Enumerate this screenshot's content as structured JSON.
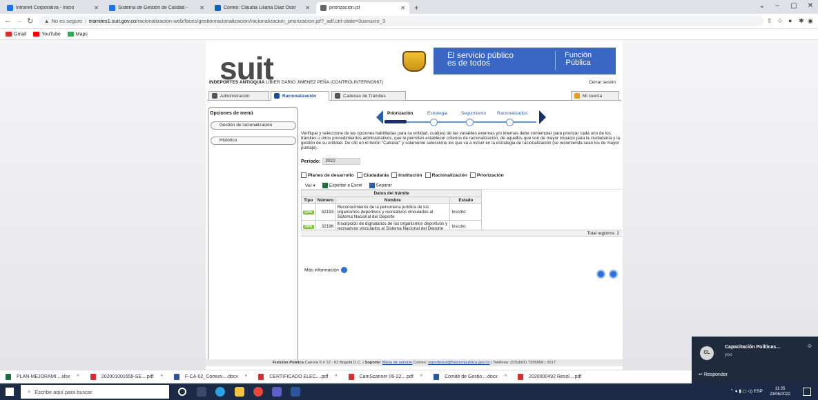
{
  "browser": {
    "tabs": [
      {
        "title": "Intranet Corporativa - Inicio",
        "color": "#1a73e8"
      },
      {
        "title": "Sistema de Gestión de Calidad -",
        "color": "#1a73e8"
      },
      {
        "title": "Correo: Claudia Liliana Díaz Osor",
        "color": "#0a66c2"
      },
      {
        "title": "priorizacion.jsf",
        "color": "#666666"
      }
    ],
    "new_tab": "+",
    "security": "No es seguro",
    "url_host": "tramites1.suit.gov.co",
    "url_path": "/racionalizacion-web/faces/gestionracionalizacion/racionalizacion_priorizacion.jsf?_adf.ctrl-state=3usnuxro_3",
    "bookmarks": [
      {
        "label": "Gmail",
        "color": "#d93025"
      },
      {
        "label": "YouTube",
        "color": "#ff0000"
      },
      {
        "label": "Maps",
        "color": "#34a853"
      }
    ]
  },
  "site": {
    "logo": "suit",
    "banner_line1": "El servicio público",
    "banner_line2": "es de todos",
    "banner_right1": "Función",
    "banner_right2": "Pública",
    "user_entity": "INDEPORTES ANTIOQUIA",
    "user_name": "LIBIER DARIO JIMENEZ PEÑA (CONTROLINTERNO967)",
    "logout": "Cerrar sesión",
    "nav_tabs": [
      "Administración",
      "Racionalización",
      "Cadenas de Trámites"
    ],
    "my_account": "Mi cuenta",
    "menu_title": "Opciones de menú",
    "menu_items": [
      "Gestión de racionalización",
      "Histórico"
    ],
    "steps": [
      "Priorización",
      "Estrategia",
      "Seguimiento",
      "Racionalizados"
    ],
    "description": "Verifique y seleccione de las opciones habilitadas para su entidad, cuál(es) de las variables externas y/o internas debe contemplar para priorizar cada uno de los trámites u otros procedimientos administrativos, que le permiten establecer criterios de racionalización, de aquellos que son de mayor impacto para la ciudadanía y la gestión de su entidad. De clic en el botón \"Calcular\" y solamente seleccione los que va a incluir en la estrategia de racionalización (se recomienda sean los de mayor puntaje).",
    "period_label": "Periodo:",
    "period_value": "2022",
    "filters": [
      "Planes de desarrollo",
      "Ciudadanía",
      "Institución",
      "Racionalización",
      "Priorización"
    ],
    "toolbar": {
      "view": "Ver ▾",
      "export": "Exportar a Excel",
      "separate": "Separar"
    },
    "table": {
      "group_header": "Datos del trámite",
      "columns": [
        "Tipo",
        "Número",
        "Nombre",
        "Estado"
      ],
      "rows": [
        {
          "tipo": "OPA",
          "numero": "32193",
          "nombre": "Reconocimiento de la personería jurídica de los organismos deportivos y recreativos vinculados al Sistema Nacional del Deporte",
          "estado": "Inscrito"
        },
        {
          "tipo": "OPA",
          "numero": "32196",
          "nombre": "Inscripción de dignatarios de los organismos deportivos y recreativos vinculados al Sistema Nacional del Deporte",
          "estado": "Inscrito"
        }
      ],
      "total": "Total registros: 2"
    },
    "more_info": "Más información",
    "footer_org": "Función Pública",
    "footer_addr": "Carrera 6 # 12 - 62 Bogotá D.C. |",
    "footer_support": "Soporte:",
    "footer_desk": "Mesa de servicio",
    "footer_mail_label": "Correo:",
    "footer_mail": "soportesuit@funcionpublica.gov.co",
    "footer_phone": "| Teléfono: (57)(601) 7395656 | 2017"
  },
  "notification": {
    "avatar": "CL",
    "title": "Capacitación Políticas...",
    "subtitle": "yoo",
    "reply": "Responder"
  },
  "downloads": [
    {
      "name": "PLAN-MEJORAMI....xlsx",
      "color": "#1d6f42"
    },
    {
      "name": "202001001659-SE....pdf",
      "color": "#d32f2f"
    },
    {
      "name": "F-CA-02_Comuni....docx",
      "color": "#2b579a"
    },
    {
      "name": "CERTIFICADO ELEC....pdf",
      "color": "#d32f2f"
    },
    {
      "name": "CamScanner 06-22....pdf",
      "color": "#d32f2f"
    },
    {
      "name": "Comité de Gestio....docx",
      "color": "#2b579a"
    },
    {
      "name": "2020000492 Resol....pdf",
      "color": "#d32f2f"
    }
  ],
  "taskbar": {
    "search": "Escribe aquí para buscar",
    "lang": "ESP",
    "time": "11:35",
    "date": "23/06/2022"
  }
}
